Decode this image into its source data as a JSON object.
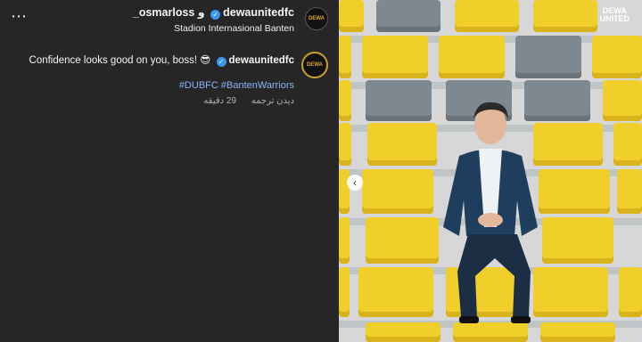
{
  "panel": {
    "more_icon": "⋯",
    "header": {
      "user1": "dewaunitedfc",
      "and": "و",
      "user2": "_osmarloss",
      "location": "Stadion Internasional Banten"
    },
    "comment": {
      "text": "Confidence looks good on you, boss! 😎",
      "user": "dewaunitedfc"
    },
    "hashtags": "#DUBFC #BantenWarriors",
    "meta": {
      "time": "29 دقیقه",
      "translate": "دیدن ترجمه"
    },
    "avatar_text": "DEWA"
  },
  "photo": {
    "logo_line1": "DEWA",
    "logo_line2": "UNITED",
    "prev_icon": "‹"
  }
}
